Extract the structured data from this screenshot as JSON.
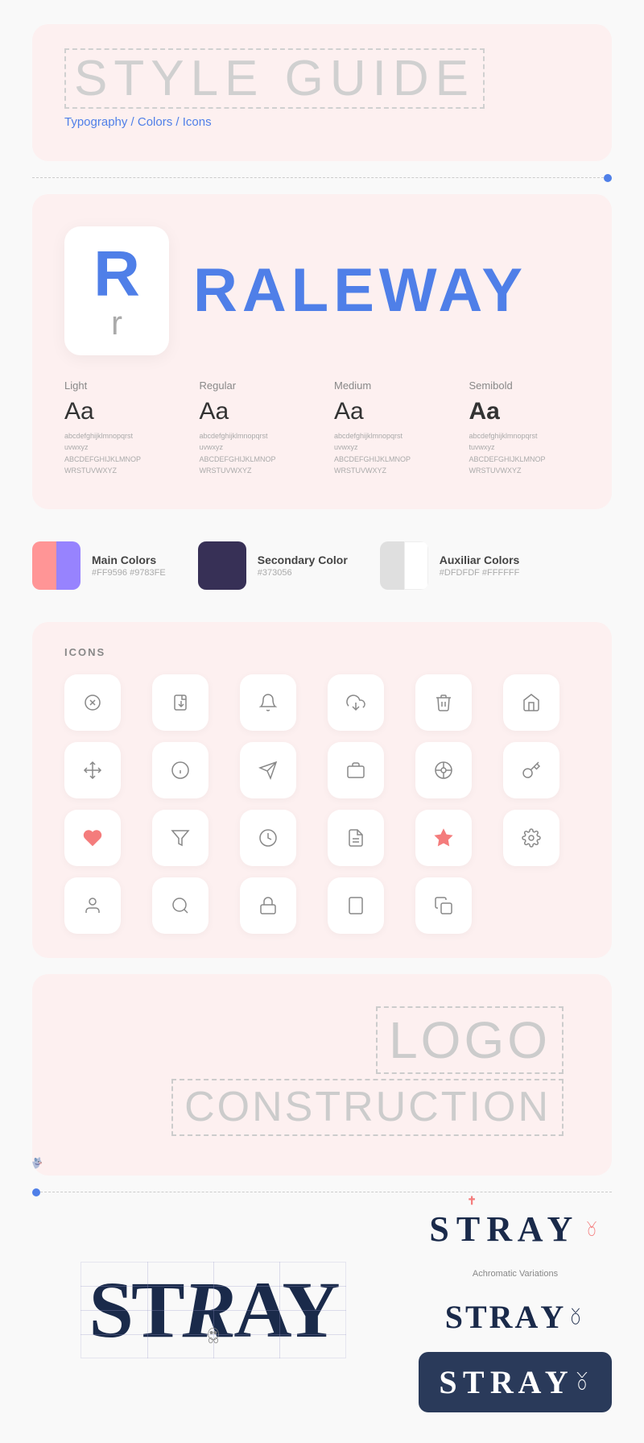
{
  "header": {
    "title": "STYLE GUIDE",
    "breadcrumb": "Typography / Colors / Icons"
  },
  "typography": {
    "font_name": "RALEWAY",
    "letter_cap": "R",
    "letter_lower": "r",
    "weights": [
      {
        "label": "Light",
        "weight_class": "light",
        "sample": "Aa",
        "chars": "abcdefghijklmnopqrst\nuvwxyz\nABCDEFGHIJKLMNOP\nWRSTUVWXYZ"
      },
      {
        "label": "Regular",
        "weight_class": "regular",
        "sample": "Aa",
        "chars": "abcdefghijklmnopqrst\nuvwxyz\nABCDEFGHIJKLMNOP\nWRSTUVWXYZ"
      },
      {
        "label": "Medium",
        "weight_class": "medium",
        "sample": "Aa",
        "chars": "abcdefghijklmnopqrst\nuvwxyz\nABCDEFGHIJKLMNOP\nWRSTUVWXYZ"
      },
      {
        "label": "Semibold",
        "weight_class": "semibold",
        "sample": "Aa",
        "chars": "abcdefghijklmnopqrst\ntuvwxyz\nABCDEFGHIJKLMNOP\nWRSTUVWXYZ"
      }
    ]
  },
  "colors": {
    "main": {
      "name": "Main Colors",
      "hex": "#FF9596  #9783FE",
      "color1": "#FF9596",
      "color2": "#9783FE"
    },
    "secondary": {
      "name": "Secondary Color",
      "hex": "#373056",
      "color": "#373056"
    },
    "aux": {
      "name": "Auxiliar Colors",
      "hex": "#DFDFDF  #FFFFFF",
      "color1": "#DFDFDF",
      "color2": "#FFFFFF"
    }
  },
  "icons": {
    "section_label": "ICONS",
    "items": [
      {
        "name": "close-circle-icon",
        "symbol": "✕",
        "pink": false
      },
      {
        "name": "forward-icon",
        "symbol": "▷",
        "pink": false
      },
      {
        "name": "bell-icon",
        "symbol": "🔔",
        "pink": false
      },
      {
        "name": "download-icon",
        "symbol": "⬇",
        "pink": false
      },
      {
        "name": "trash-icon",
        "symbol": "🗑",
        "pink": false
      },
      {
        "name": "home-icon",
        "symbol": "⌂",
        "pink": false
      },
      {
        "name": "move-icon",
        "symbol": "✛",
        "pink": false
      },
      {
        "name": "info-icon",
        "symbol": "ℹ",
        "pink": false
      },
      {
        "name": "send-icon",
        "symbol": "➤",
        "pink": false
      },
      {
        "name": "briefcase-icon",
        "symbol": "💼",
        "pink": false
      },
      {
        "name": "target-icon",
        "symbol": "◎",
        "pink": false
      },
      {
        "name": "key-icon",
        "symbol": "⚿",
        "pink": false
      },
      {
        "name": "heart-icon",
        "symbol": "♥",
        "pink": true
      },
      {
        "name": "filter-icon",
        "symbol": "⛉",
        "pink": false
      },
      {
        "name": "clock-icon",
        "symbol": "○",
        "pink": false
      },
      {
        "name": "file-icon",
        "symbol": "📄",
        "pink": false
      },
      {
        "name": "star-icon",
        "symbol": "★",
        "pink": true
      },
      {
        "name": "settings-icon",
        "symbol": "⚙",
        "pink": false
      },
      {
        "name": "user-icon",
        "symbol": "👤",
        "pink": false
      },
      {
        "name": "search-icon",
        "symbol": "⌕",
        "pink": false
      },
      {
        "name": "lock-icon",
        "symbol": "🔒",
        "pink": false
      },
      {
        "name": "tablet-icon",
        "symbol": "▭",
        "pink": false
      },
      {
        "name": "document-icon",
        "symbol": "📋",
        "pink": false
      }
    ]
  },
  "logo_construction": {
    "title_line1": "LOGO",
    "title_line2": "CONSTRUCTION"
  },
  "logos": {
    "main_text": "StRAY",
    "achromatic_label": "Achromatic Variations",
    "variant1_text": "StRAY",
    "variant2_text": "StRAY",
    "variant3_text": "STRAY"
  }
}
